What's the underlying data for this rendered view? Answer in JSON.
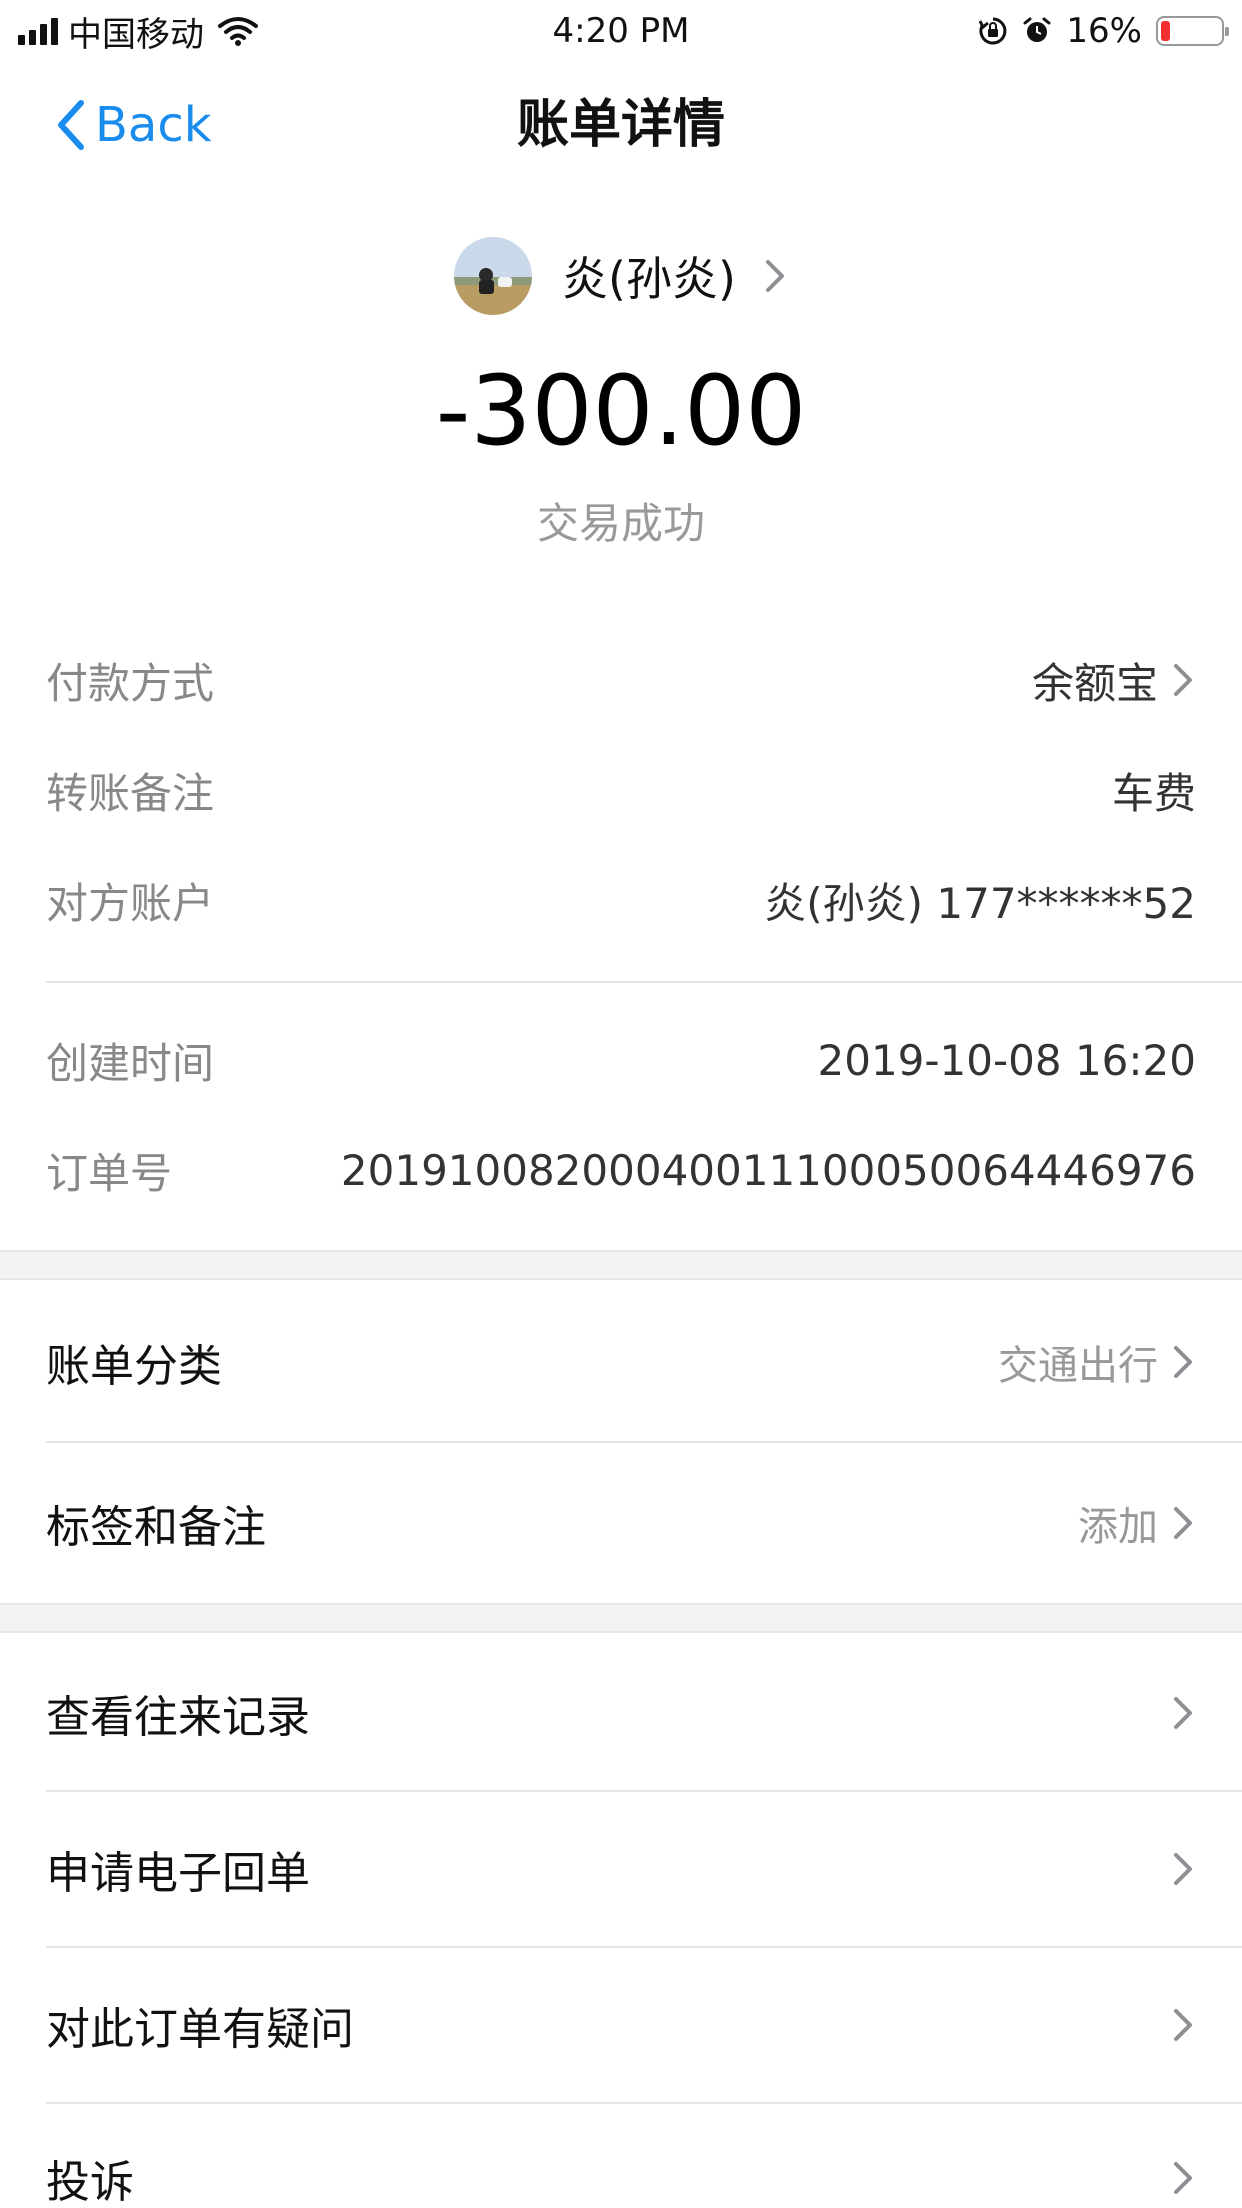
{
  "status_bar": {
    "carrier": "中国移动",
    "time": "4:20 PM",
    "battery_percent": "16%",
    "battery_level": 0.16,
    "icons": [
      "signal-icon",
      "wifi-icon",
      "orientation-lock-icon",
      "alarm-icon",
      "battery-icon"
    ]
  },
  "nav": {
    "back_label": "Back",
    "title": "账单详情"
  },
  "header": {
    "payee_name": "炎(孙炎)",
    "amount": "-300.00",
    "status": "交易成功"
  },
  "details": {
    "payment_method": {
      "label": "付款方式",
      "value": "余额宝"
    },
    "transfer_note": {
      "label": "转账备注",
      "value": "车费"
    },
    "counterparty": {
      "label": "对方账户",
      "value": "炎(孙炎) 177******52"
    },
    "created_time": {
      "label": "创建时间",
      "value": "2019-10-08 16:20"
    },
    "order_number": {
      "label": "订单号",
      "value": "20191008200040011100050064446976"
    }
  },
  "category": {
    "bill_category": {
      "label": "账单分类",
      "value": "交通出行"
    },
    "tags_notes": {
      "label": "标签和备注",
      "value": "添加"
    }
  },
  "actions": {
    "history": {
      "label": "查看往来记录"
    },
    "e_receipt": {
      "label": "申请电子回单"
    },
    "question": {
      "label": "对此订单有疑问"
    },
    "complaint": {
      "label": "投诉"
    }
  },
  "colors": {
    "accent": "#1a8ced",
    "battery_low": "#f23030",
    "secondary_text": "#999999",
    "separator_band": "#f3f3f5"
  }
}
